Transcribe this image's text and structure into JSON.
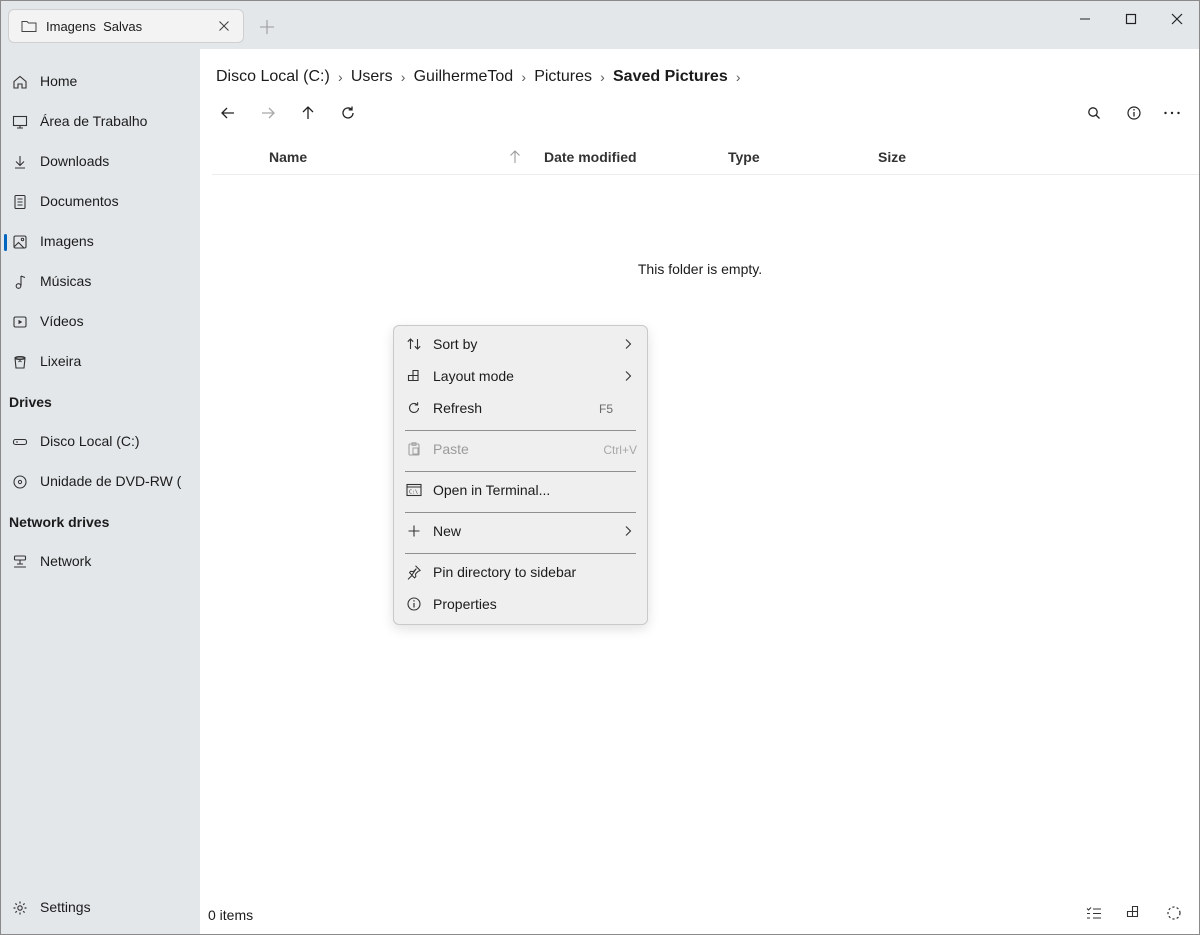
{
  "titlebar": {
    "tab_label": "Imagens  Salvas",
    "tab_icon": "folder-icon",
    "window_controls": [
      "minimize-icon",
      "maximize-icon",
      "close-icon"
    ]
  },
  "sidebar": {
    "items": [
      {
        "label": "Home",
        "icon": "home-icon"
      },
      {
        "label": "Área de Trabalho",
        "icon": "desktop-icon"
      },
      {
        "label": "Downloads",
        "icon": "download-icon"
      },
      {
        "label": "Documentos",
        "icon": "document-icon"
      },
      {
        "label": "Imagens",
        "icon": "image-icon",
        "active": true
      },
      {
        "label": "Músicas",
        "icon": "music-icon"
      },
      {
        "label": "Vídeos",
        "icon": "video-icon"
      },
      {
        "label": "Lixeira",
        "icon": "recycle-bin-icon"
      }
    ],
    "drives_header": "Drives",
    "drives": [
      {
        "label": "Disco Local (C:)",
        "icon": "drive-icon"
      },
      {
        "label": "Unidade de DVD-RW (D:)",
        "icon": "dvd-icon"
      }
    ],
    "network_header": "Network drives",
    "network": [
      {
        "label": "Network",
        "icon": "network-icon"
      }
    ],
    "settings_label": "Settings"
  },
  "breadcrumb": [
    "Disco Local (C:)",
    "Users",
    "GuilhermeTod",
    "Pictures",
    "Saved Pictures"
  ],
  "columns": {
    "name": "Name",
    "date_modified": "Date modified",
    "type": "Type",
    "size": "Size"
  },
  "empty_message": "This folder is empty.",
  "status": {
    "item_count": "0 items"
  },
  "context_menu": {
    "items": [
      {
        "label": "Sort by",
        "icon": "sort-icon",
        "submenu": true
      },
      {
        "label": "Layout mode",
        "icon": "layout-icon",
        "submenu": true
      },
      {
        "label": "Refresh",
        "icon": "refresh-icon",
        "shortcut": "F5"
      },
      {
        "label": "Paste",
        "icon": "paste-icon",
        "shortcut": "Ctrl+V",
        "disabled": true
      },
      {
        "label": "Open in Terminal...",
        "icon": "terminal-icon"
      },
      {
        "label": "New",
        "icon": "plus-icon",
        "submenu": true
      },
      {
        "label": "Pin directory to sidebar",
        "icon": "pin-icon"
      },
      {
        "label": "Properties",
        "icon": "info-icon"
      }
    ]
  },
  "colors": {
    "accent": "#0067c0",
    "sidebar_bg": "#e3e7ea",
    "content_bg": "#ffffff",
    "menu_bg": "#efefef"
  }
}
